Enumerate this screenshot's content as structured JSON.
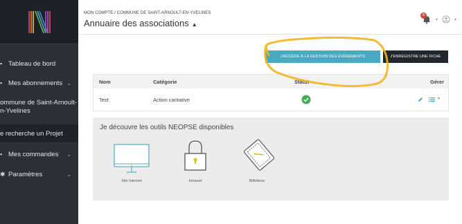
{
  "sidebar": {
    "items": [
      {
        "icon": "dashboard-icon",
        "label": "Tableau de bord",
        "chevron": false
      },
      {
        "icon": "subscriptions-icon",
        "label": "Mes abonnements",
        "chevron": true
      },
      {
        "icon": "commune-icon",
        "label_line1": "ommune de Saint-Arnoult-",
        "label_line2": "n-Yvelines",
        "chevron": false
      },
      {
        "icon": "",
        "label": "e recherche un Projet",
        "chevron": false
      },
      {
        "icon": "orders-icon",
        "label": "Mes commandes",
        "chevron": true
      },
      {
        "icon": "settings-icon",
        "label": "Paramètres",
        "chevron": true
      }
    ]
  },
  "header": {
    "breadcrumb": "MON COMPTE / COMMUNE DE SAINT-ARNOULT-EN-YVELINES",
    "title": "Annuaire des associations",
    "notif_count": "8"
  },
  "actions": {
    "events_button": "J'ACCÈDE À LA GESTION DES ÉVÉNEMENTS",
    "register_button": "J'ENREGISTRE UNE FICHE"
  },
  "table": {
    "headers": {
      "nom": "Nom",
      "categorie": "Catégorie",
      "statut": "Statut",
      "gerer": "Gérer"
    },
    "rows": [
      {
        "nom": "Test",
        "categorie": "Action caritative"
      }
    ]
  },
  "tools": {
    "title": "Je découvre les outils NEOPSE disponibles",
    "items": [
      {
        "label": "Site Internet"
      },
      {
        "label": "Intranet"
      },
      {
        "label": "Billetterie"
      }
    ]
  },
  "colors": {
    "accent": "#49a9c1",
    "success": "#3fae5a",
    "highlight": "#f3b21c"
  }
}
